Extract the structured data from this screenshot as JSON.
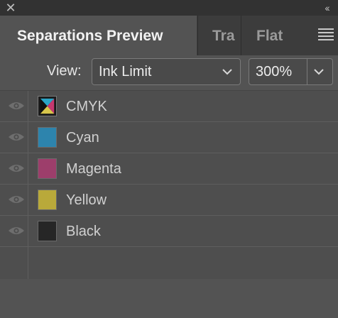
{
  "titlebar": {
    "close_icon": "close-icon",
    "collapse_icon": "double-chevron-left-icon"
  },
  "tabs": [
    {
      "label": "Separations Preview",
      "active": true
    },
    {
      "label": "Tra",
      "active": false
    },
    {
      "label": "Flat",
      "active": false
    }
  ],
  "view": {
    "label": "View:",
    "selected": "Ink Limit",
    "percent": "300%"
  },
  "separations": [
    {
      "name": "CMYK",
      "swatch": "cmyk"
    },
    {
      "name": "Cyan",
      "swatch": "#2d84ad"
    },
    {
      "name": "Magenta",
      "swatch": "#9d3e6b"
    },
    {
      "name": "Yellow",
      "swatch": "#b9a93a"
    },
    {
      "name": "Black",
      "swatch": "#262626"
    }
  ]
}
